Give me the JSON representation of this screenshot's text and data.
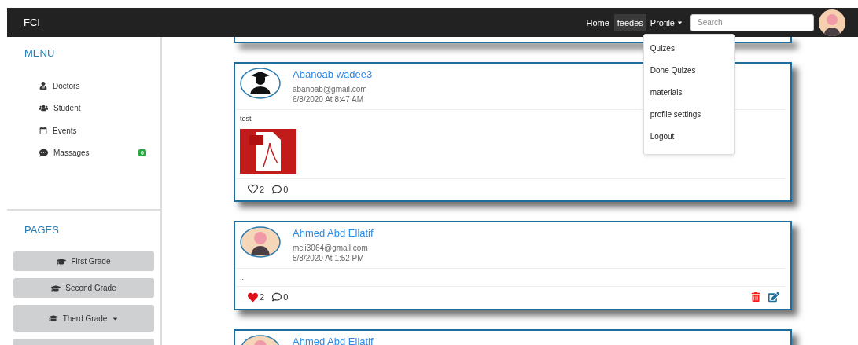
{
  "navbar": {
    "brand": "FCI",
    "links": [
      {
        "label": "Home",
        "selected": false
      },
      {
        "label": "feedes",
        "selected": true
      }
    ],
    "profile": {
      "label": "Profile",
      "menu": [
        "Quizes",
        "Done Quizes",
        "materials",
        "profile settings",
        "Logout"
      ]
    },
    "search": {
      "placeholder": "Search"
    }
  },
  "sidebar": {
    "menu_title": "MENU",
    "menu": [
      {
        "kind": "doctors",
        "label": "Doctors"
      },
      {
        "kind": "students",
        "label": "Student"
      },
      {
        "kind": "events",
        "label": "Events"
      },
      {
        "kind": "messages",
        "label": "Massages",
        "badge": "0"
      }
    ],
    "pages_title": "PAGES",
    "pages": [
      {
        "label": "First Grade",
        "dropdown": false
      },
      {
        "label": "Second Grade",
        "dropdown": false
      },
      {
        "label": "Therd Grade",
        "dropdown": true
      }
    ]
  },
  "posts": [
    {
      "default_avatar": false,
      "name": "Abanoab wadee3",
      "email": "abanoab@gmail.com",
      "date": "6/8/2020 At 8:47 AM",
      "text": "test",
      "pdf_attachment": true,
      "liked": false,
      "likes": "2",
      "comments": "0",
      "owner": false
    },
    {
      "default_avatar": true,
      "name": "Ahmed Abd Ellatif",
      "email": "mcli3064@gmail.com",
      "date": "5/8/2020 At 1:52 PM",
      "text": "..",
      "liked": true,
      "likes": "2",
      "comments": "0",
      "owner": true
    },
    {
      "default_avatar": true,
      "name": "Ahmed Abd Ellatif"
    }
  ]
}
